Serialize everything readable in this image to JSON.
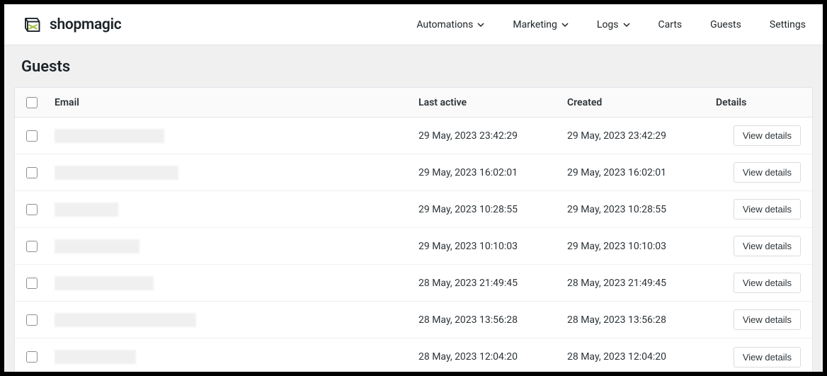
{
  "brand": {
    "name": "shopmagic"
  },
  "nav": {
    "automations": "Automations",
    "marketing": "Marketing",
    "logs": "Logs",
    "carts": "Carts",
    "guests": "Guests",
    "settings": "Settings"
  },
  "page": {
    "title": "Guests"
  },
  "table": {
    "headers": {
      "email": "Email",
      "last_active": "Last active",
      "created": "Created",
      "details": "Details"
    },
    "view_details_label": "View details",
    "rows": [
      {
        "email": "",
        "last_active": "29 May, 2023 23:42:29",
        "created": "29 May, 2023 23:42:29",
        "redact_w": 155
      },
      {
        "email": "",
        "last_active": "29 May, 2023 16:02:01",
        "created": "29 May, 2023 16:02:01",
        "redact_w": 175
      },
      {
        "email": "",
        "last_active": "29 May, 2023 10:28:55",
        "created": "29 May, 2023 10:28:55",
        "redact_w": 90
      },
      {
        "email": "",
        "last_active": "29 May, 2023 10:10:03",
        "created": "29 May, 2023 10:10:03",
        "redact_w": 120
      },
      {
        "email": "",
        "last_active": "28 May, 2023 21:49:45",
        "created": "28 May, 2023 21:49:45",
        "redact_w": 140
      },
      {
        "email": "",
        "last_active": "28 May, 2023 13:56:28",
        "created": "28 May, 2023 13:56:28",
        "redact_w": 200
      },
      {
        "email": "",
        "last_active": "28 May, 2023 12:04:20",
        "created": "28 May, 2023 12:04:20",
        "redact_w": 115
      }
    ]
  }
}
